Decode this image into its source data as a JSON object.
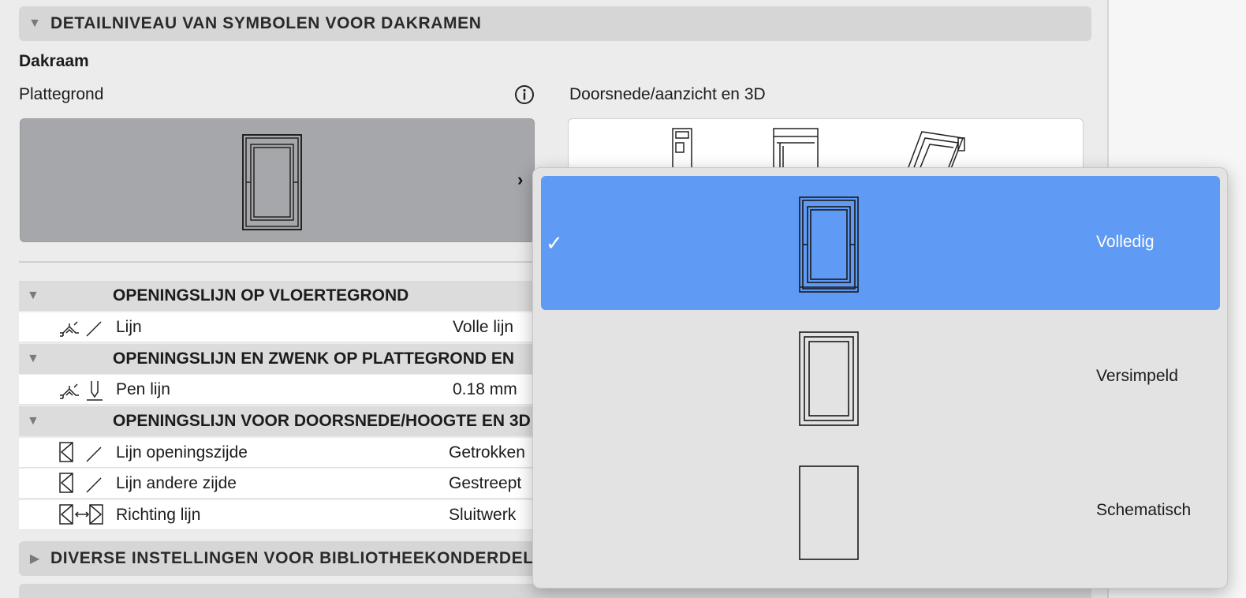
{
  "sections": {
    "top_title": "DETAILNIVEAU VAN SYMBOLEN VOOR DAKRAMEN",
    "bottom_title": "DIVERSE INSTELLINGEN VOOR BIBLIOTHEEKONDERDELEN"
  },
  "dakraam": {
    "title": "Dakraam",
    "plan_label": "Plattegrond",
    "section_label": "Doorsnede/aanzicht en 3D"
  },
  "groups": [
    {
      "label": "OPENINGSLIJN OP VLOERTEGROND"
    },
    {
      "label": "OPENINGSLIJN EN ZWENK OP PLATTEGROND EN"
    },
    {
      "label": "OPENINGSLIJN VOOR DOORSNEDE/HOOGTE EN 3D"
    }
  ],
  "rows": [
    {
      "name": "Lijn",
      "value": "Volle lijn"
    },
    {
      "name": "Pen lijn",
      "value": "0.18 mm"
    },
    {
      "name": "Lijn openingszijde",
      "value": "Getrokken"
    },
    {
      "name": "Lijn andere zijde",
      "value": "Gestreept"
    },
    {
      "name": "Richting lijn",
      "value": "Sluitwerk"
    }
  ],
  "dropdown": {
    "options": [
      {
        "label": "Volledig",
        "selected": true
      },
      {
        "label": "Versimpeld",
        "selected": false
      },
      {
        "label": "Schematisch",
        "selected": false
      }
    ]
  },
  "colors": {
    "selection": "#5f9af5",
    "header_bg": "#d6d6d6",
    "panel_bg": "#ececec",
    "preview_bg": "#a6a7aa"
  }
}
